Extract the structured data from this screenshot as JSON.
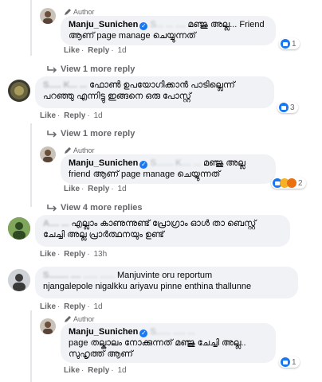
{
  "comments": [
    {
      "author_tag": "Author",
      "name": "Manju_Sunichen",
      "line1_blur": "S... ... ....",
      "line1": "മഞ്ജു അല്ല... Friend",
      "line2": "ആണ് page manage ചെയ്യുന്നത്",
      "actions": {
        "like": "Like",
        "reply": "Reply",
        "time": "1d"
      },
      "reaction_count": "1"
    },
    {
      "more_replies": "View 1 more reply"
    },
    {
      "name_blur": "S..... K... ...",
      "line1": "ഫോൺ ഉപയോഗിക്കാൻ പാടില്ലെന്ന്",
      "line2": "പറഞ്ഞു എന്നിട്ടു ഇങ്ങനെ ഒരു പോസ്റ്റ്",
      "actions": {
        "like": "Like",
        "reply": "Reply",
        "time": "1d"
      },
      "reaction_count": "3"
    },
    {
      "more_replies": "View 1 more reply"
    },
    {
      "author_tag": "Author",
      "name": "Manju_Sunichen",
      "line1_blur": "S....... K.... ...",
      "line1": "മഞ്ജു അല്ല",
      "line2": "friend ആണ് page manage ചെയ്യുന്നത്",
      "actions": {
        "like": "Like",
        "reply": "Reply",
        "time": "1d"
      },
      "reaction_count": "2"
    },
    {
      "more_replies": "View 4 more replies"
    },
    {
      "name_blur": "A.... ...",
      "line1": "എല്ലാം കാണുന്നുണ്ട് പ്രോഗ്രാം ഓൾ താ ബെസ്റ്റ്",
      "line2": "ചേച്ചി അല്ല പ്രാർത്ഥനയും ഉണ്ട്",
      "actions": {
        "like": "Like",
        "reply": "Reply",
        "time": "13h"
      },
      "reaction_count": ""
    },
    {
      "name_blur": "S........ ....",
      "line1_blur": "...... ......",
      "line1": "Manjuvinte oru reportum",
      "line2": "njangalepole nigalkku ariyavu pinne enthina thallunne",
      "actions": {
        "like": "Like",
        "reply": "Reply",
        "time": "1d"
      },
      "reaction_count": ""
    },
    {
      "author_tag": "Author",
      "name": "Manju_Sunichen",
      "line1_blur": "S...... ..... ...",
      "line2": "page തല്കാലം നോക്കുന്നത് മഞ്ജു ചേച്ചി അല്ല..",
      "line3": "സുഹൃത്ത് ആണ്",
      "actions": {
        "like": "Like",
        "reply": "Reply",
        "time": "1d"
      },
      "reaction_count": "1"
    }
  ],
  "colors": {
    "bubble": "#f0f2f5",
    "meta": "#65676b",
    "accent": "#1877f2"
  }
}
